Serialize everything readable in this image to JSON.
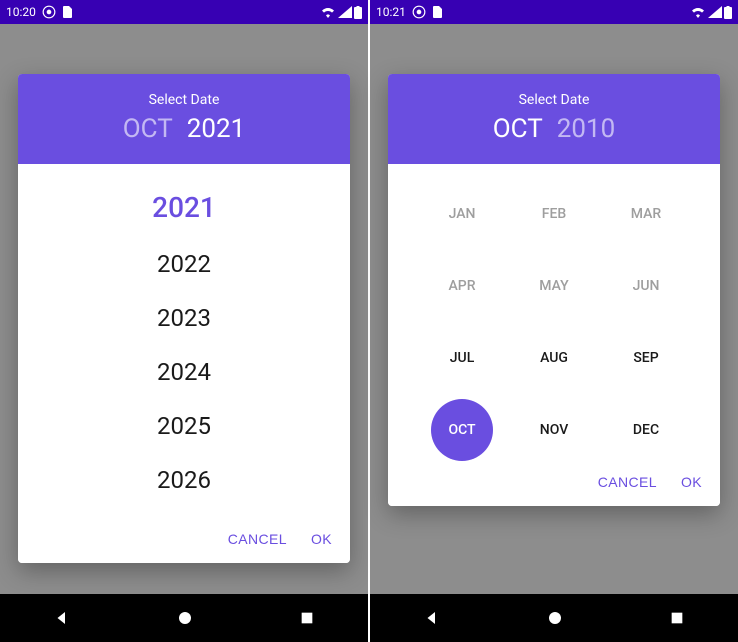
{
  "colors": {
    "primary": "#6a4ee0",
    "primaryDark": "#3700b3"
  },
  "left": {
    "statusTime": "10:20",
    "header": {
      "title": "Select Date",
      "month": "OCT",
      "year": "2021",
      "active": "year"
    },
    "years": [
      "2021",
      "2022",
      "2023",
      "2024",
      "2025",
      "2026"
    ],
    "selectedYear": "2021",
    "actions": {
      "cancel": "CANCEL",
      "ok": "OK"
    }
  },
  "right": {
    "statusTime": "10:21",
    "header": {
      "title": "Select Date",
      "month": "OCT",
      "year": "2010",
      "active": "month"
    },
    "months": [
      "JAN",
      "FEB",
      "MAR",
      "APR",
      "MAY",
      "JUN",
      "JUL",
      "AUG",
      "SEP",
      "OCT",
      "NOV",
      "DEC"
    ],
    "dimMonths": [
      "JAN",
      "FEB",
      "MAR",
      "APR",
      "MAY",
      "JUN"
    ],
    "selectedMonth": "OCT",
    "actions": {
      "cancel": "CANCEL",
      "ok": "OK"
    }
  },
  "icons": {
    "circleDot": "circle-dot-icon",
    "sim": "sim-icon",
    "wifi": "wifi-icon",
    "signal": "signal-icon",
    "battery": "battery-icon",
    "back": "back-icon",
    "home": "home-icon",
    "recent": "recent-icon"
  }
}
